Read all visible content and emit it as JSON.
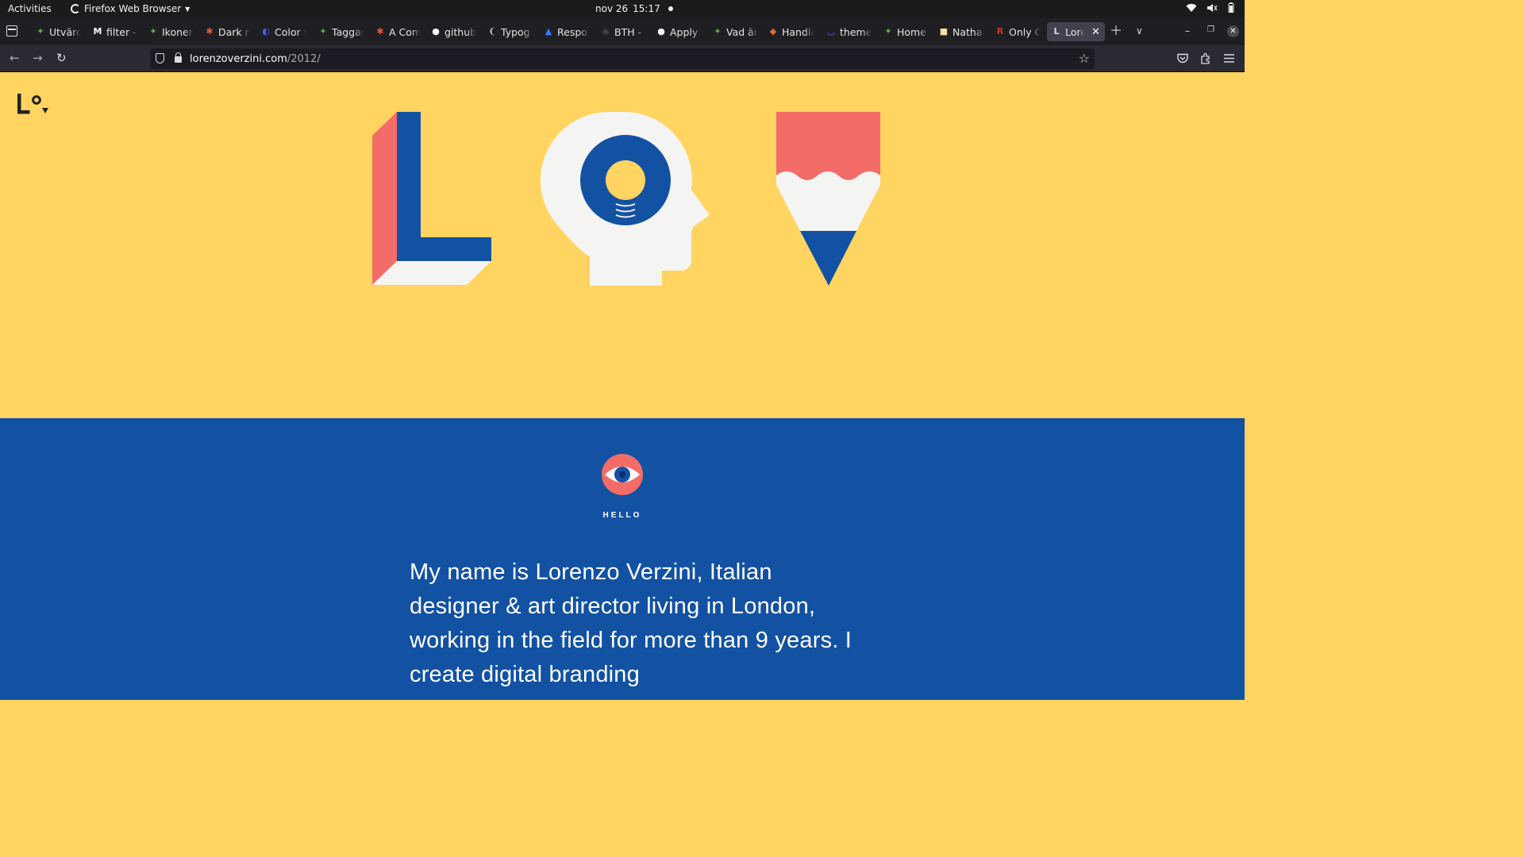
{
  "system": {
    "activities": "Activities",
    "app_name": "Firefox Web Browser",
    "clock_date": "nov 26",
    "clock_time": "15:17"
  },
  "tabs": [
    {
      "title": "Utvärd",
      "icon": "green-leaf-icon",
      "color": "#6aa84f"
    },
    {
      "title": "filter -",
      "icon": "medium-icon",
      "color": "#ffffff"
    },
    {
      "title": "Ikoner",
      "icon": "green-leaf-icon",
      "color": "#6aa84f"
    },
    {
      "title": "Dark n",
      "icon": "asterisk-icon",
      "color": "#e8553c"
    },
    {
      "title": "Color v",
      "icon": "colorbox-icon",
      "color": "#4a5cff"
    },
    {
      "title": "Taggar",
      "icon": "green-leaf-icon",
      "color": "#6aa84f"
    },
    {
      "title": "A Com",
      "icon": "asterisk-icon",
      "color": "#e8553c"
    },
    {
      "title": "github",
      "icon": "github-icon",
      "color": "#ffffff"
    },
    {
      "title": "Typog",
      "icon": "typography-icon",
      "color": "#cccccc"
    },
    {
      "title": "Respo",
      "icon": "responsive-icon",
      "color": "#2d7ff9"
    },
    {
      "title": "BTH - (",
      "icon": "bth-icon",
      "color": "#444444"
    },
    {
      "title": "Apply",
      "icon": "github-icon",
      "color": "#ffffff"
    },
    {
      "title": "Vad är",
      "icon": "green-leaf-icon",
      "color": "#6aa84f"
    },
    {
      "title": "Handle",
      "icon": "handle-icon",
      "color": "#e56b2e"
    },
    {
      "title": "theme",
      "icon": "theme-icon",
      "color": "#6c5ce7"
    },
    {
      "title": "Home",
      "icon": "green-leaf-icon",
      "color": "#6aa84f"
    },
    {
      "title": "Nathan",
      "icon": "nathan-icon",
      "color": "#f3e3a0"
    },
    {
      "title": "Only C",
      "icon": "r-icon",
      "color": "#d0312d"
    },
    {
      "title": "Lore",
      "icon": "lorenzo-icon",
      "color": "#dddddd"
    }
  ],
  "url": {
    "host": "lorenzoverzini.com",
    "path": "/2012/"
  },
  "page": {
    "hello_label": "HELLO",
    "intro_text": "My name is Lorenzo Verzini, Italian designer & art director living in London, working in the field for more than 9 years. I create digital branding"
  },
  "colors": {
    "yellow": "#ffd461",
    "blue": "#1352a2",
    "coral": "#f36c67",
    "offwhite": "#f4f4f2"
  }
}
